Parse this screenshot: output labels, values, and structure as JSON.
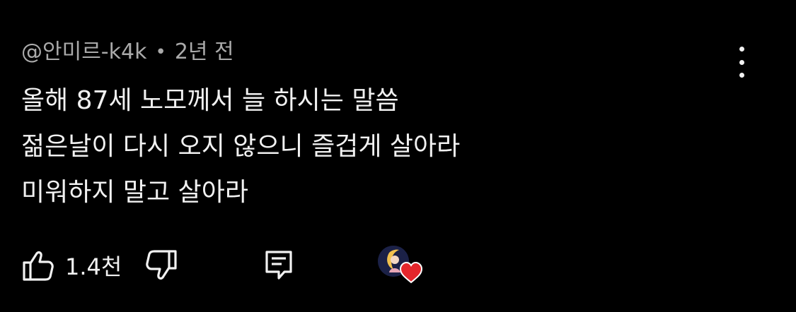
{
  "comment": {
    "author": "@안미르-k4k",
    "separator": "•",
    "time_ago": "2년 전",
    "lines": [
      "올해 87세 노모께서 늘 하시는 말씀",
      "젊은날이 다시 오지 않으니 즐겁게 살아라",
      "미워하지 말고 살아라"
    ]
  },
  "actions": {
    "like_count": "1.4천",
    "icons": {
      "like": "thumbs-up-icon",
      "dislike": "thumbs-down-icon",
      "reply": "reply-comment-icon",
      "menu": "more-vert-icon",
      "creator_heart": "creator-heart-icon"
    }
  },
  "colors": {
    "background": "#000000",
    "text": "#f1f1f1",
    "meta": "#aaaaaa",
    "heart": "#e4262b"
  }
}
